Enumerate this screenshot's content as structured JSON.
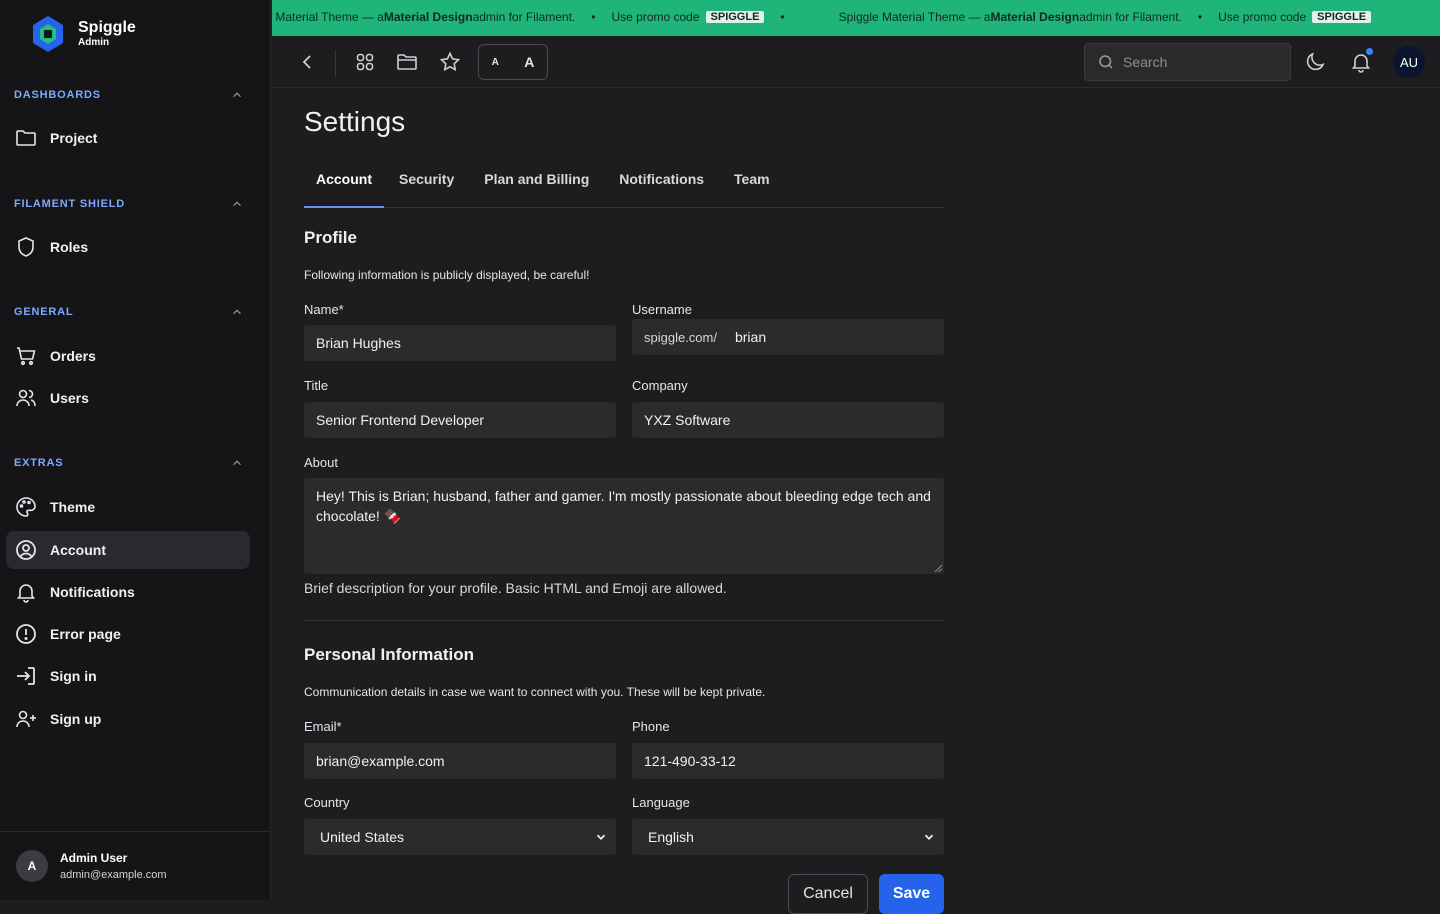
{
  "brand": {
    "name": "Spiggle",
    "sub": "Admin"
  },
  "sidebar": {
    "groups": [
      {
        "title": "DASHBOARDS",
        "items": [
          {
            "label": "Project",
            "icon": "folder-icon"
          }
        ]
      },
      {
        "title": "FILAMENT SHIELD",
        "items": [
          {
            "label": "Roles",
            "icon": "shield-icon"
          }
        ]
      },
      {
        "title": "GENERAL",
        "items": [
          {
            "label": "Orders",
            "icon": "cart-icon"
          },
          {
            "label": "Users",
            "icon": "users-icon"
          }
        ]
      },
      {
        "title": "EXTRAS",
        "items": [
          {
            "label": "Theme",
            "icon": "palette-icon"
          },
          {
            "label": "Account",
            "icon": "user-circle-icon",
            "active": true
          },
          {
            "label": "Notifications",
            "icon": "bell-icon"
          },
          {
            "label": "Error page",
            "icon": "alert-circle-icon"
          },
          {
            "label": "Sign in",
            "icon": "sign-in-icon"
          },
          {
            "label": "Sign up",
            "icon": "user-plus-icon"
          }
        ]
      }
    ],
    "user": {
      "initial": "A",
      "name": "Admin User",
      "email": "admin@example.com"
    }
  },
  "promo": {
    "prefix": "Spiggle Material Theme — a ",
    "bold": "Material Design",
    "suffix": " admin for Filament.",
    "promo_text": "Use promo code",
    "code": "SPIGGLE",
    "accent": "#1fb57a"
  },
  "topbar": {
    "font_small": "A",
    "font_large": "A",
    "search_placeholder": "Search",
    "avatar": "AU"
  },
  "page": {
    "title": "Settings",
    "tabs": [
      "Account",
      "Security",
      "Plan and Billing",
      "Notifications",
      "Team"
    ],
    "active_tab": "Account"
  },
  "profile": {
    "heading": "Profile",
    "description": "Following information is publicly displayed, be careful!",
    "name_label": "Name*",
    "name_value": "Brian Hughes",
    "username_label": "Username",
    "username_prefix": "spiggle.com/",
    "username_value": "brian",
    "title_label": "Title",
    "title_value": "Senior Frontend Developer",
    "company_label": "Company",
    "company_value": "YXZ Software",
    "about_label": "About",
    "about_value": "Hey! This is Brian; husband, father and gamer. I'm mostly passionate about bleeding edge tech and chocolate! 🍫",
    "about_hint": "Brief description for your profile. Basic HTML and Emoji are allowed."
  },
  "personal": {
    "heading": "Personal Information",
    "description": "Communication details in case we want to connect with you. These will be kept private.",
    "email_label": "Email*",
    "email_value": "brian@example.com",
    "phone_label": "Phone",
    "phone_value": "121-490-33-12",
    "country_label": "Country",
    "country_value": "United States",
    "language_label": "Language",
    "language_value": "English"
  },
  "actions": {
    "cancel": "Cancel",
    "save": "Save",
    "save_color": "#2563eb"
  }
}
